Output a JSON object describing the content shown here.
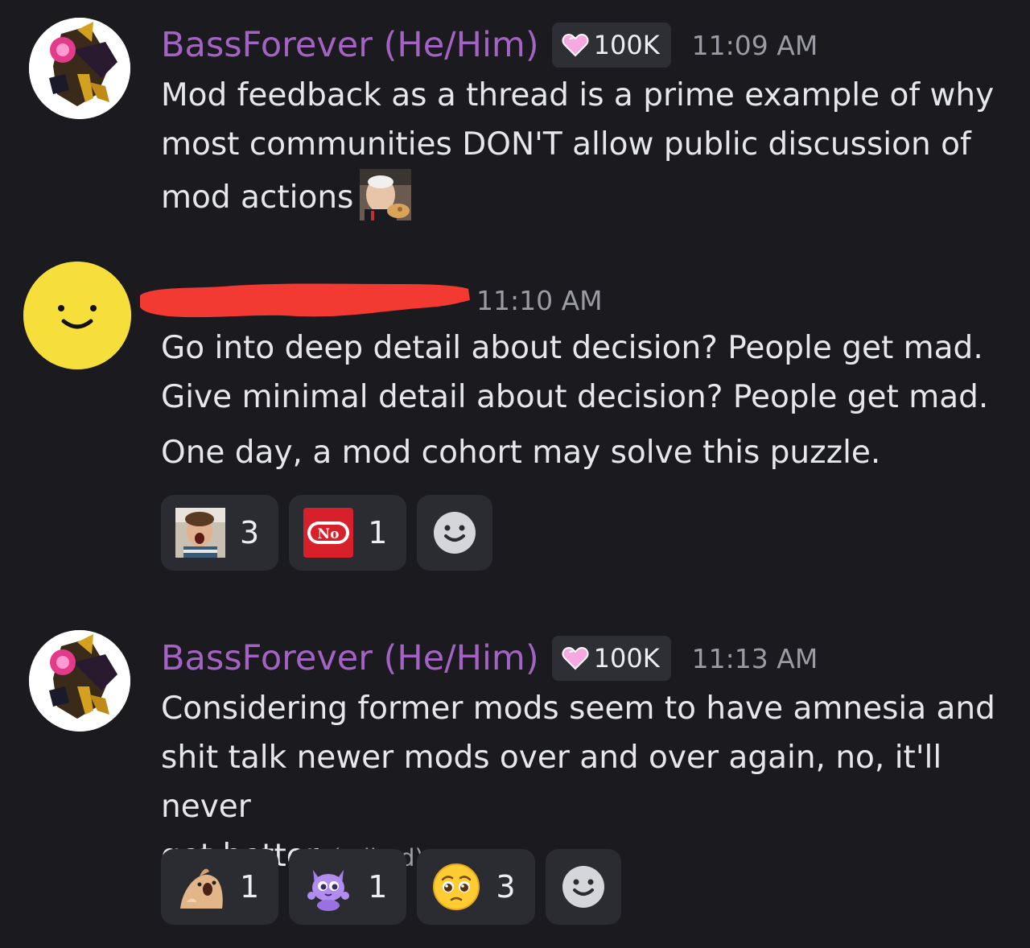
{
  "messages": [
    {
      "username": "BassForever (He/Him)",
      "badge": "100K",
      "timestamp": "11:09 AM",
      "lines": [
        "Mod feedback as a thread is a prime example of why",
        "most communities DON'T allow public discussion of",
        "mod actions"
      ]
    },
    {
      "username": "",
      "timestamp": "11:10 AM",
      "lines": [
        "Go into deep detail about decision? People get mad.",
        "Give minimal detail about decision? People get mad.",
        "One day, a mod cohort may solve this puzzle."
      ],
      "reactions": [
        {
          "icon": "screaming-child-emoji",
          "count": "3"
        },
        {
          "icon": "no-sign-emoji",
          "icon_text": "No",
          "count": "1"
        },
        {
          "icon": "add-reaction-icon"
        }
      ]
    },
    {
      "username": "BassForever (He/Him)",
      "badge": "100K",
      "timestamp": "11:13 AM",
      "lines": [
        "Considering former mods seem to have amnesia and",
        "shit talk newer mods over and over again, no, it'll never",
        "get better"
      ],
      "edited": "(edited)",
      "reactions": [
        {
          "icon": "screaming-hamster-emoji",
          "count": "1"
        },
        {
          "icon": "purple-cat-emoji",
          "count": "1"
        },
        {
          "icon": "pleading-face-emoji",
          "count": "3"
        },
        {
          "icon": "add-reaction-icon"
        }
      ]
    }
  ],
  "colors": {
    "background": "#1b1b1f",
    "username": "#a463c4",
    "badge_bg": "#2e2f35",
    "timestamp": "#9b9ca3",
    "reaction_bg": "#2b2c31",
    "redaction": "#f23a33"
  }
}
